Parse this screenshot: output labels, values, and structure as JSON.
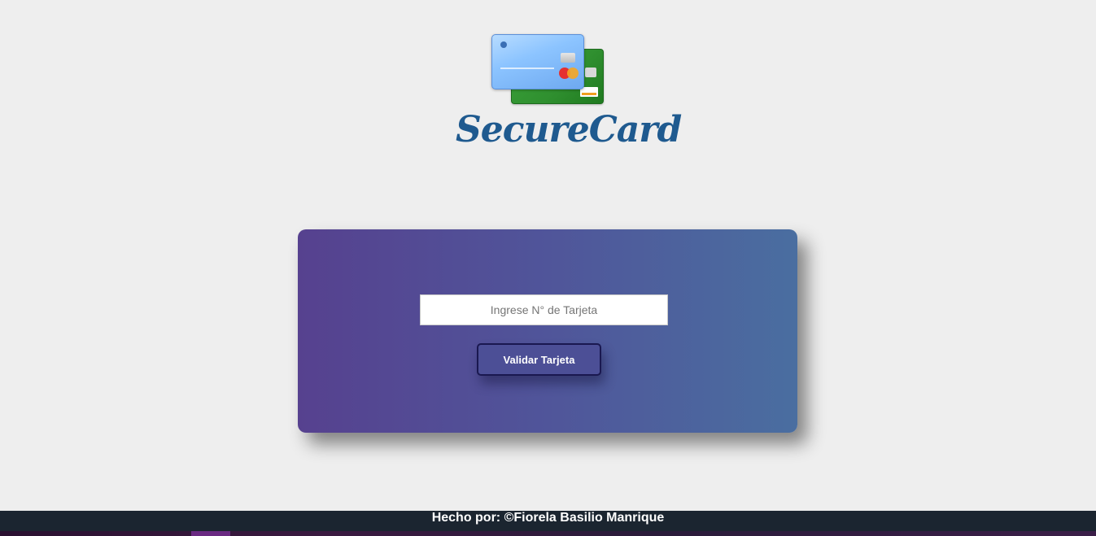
{
  "logo": {
    "brand_text": "SecureCard",
    "icon": "credit-cards-icon"
  },
  "form": {
    "card_input": {
      "placeholder": "Ingrese N° de Tarjeta",
      "value": ""
    },
    "validate_button_label": "Validar Tarjeta"
  },
  "footer": {
    "credit_text": "Hecho por: ©Fiorela Basilio Manrique"
  },
  "colors": {
    "background": "#eeeeee",
    "panel_gradient_start": "#56418f",
    "panel_gradient_end": "#4a6ea0",
    "brand_text": "#1f5a8f",
    "button_bg": "#4c4f96",
    "footer_bg": "#1b2530"
  }
}
